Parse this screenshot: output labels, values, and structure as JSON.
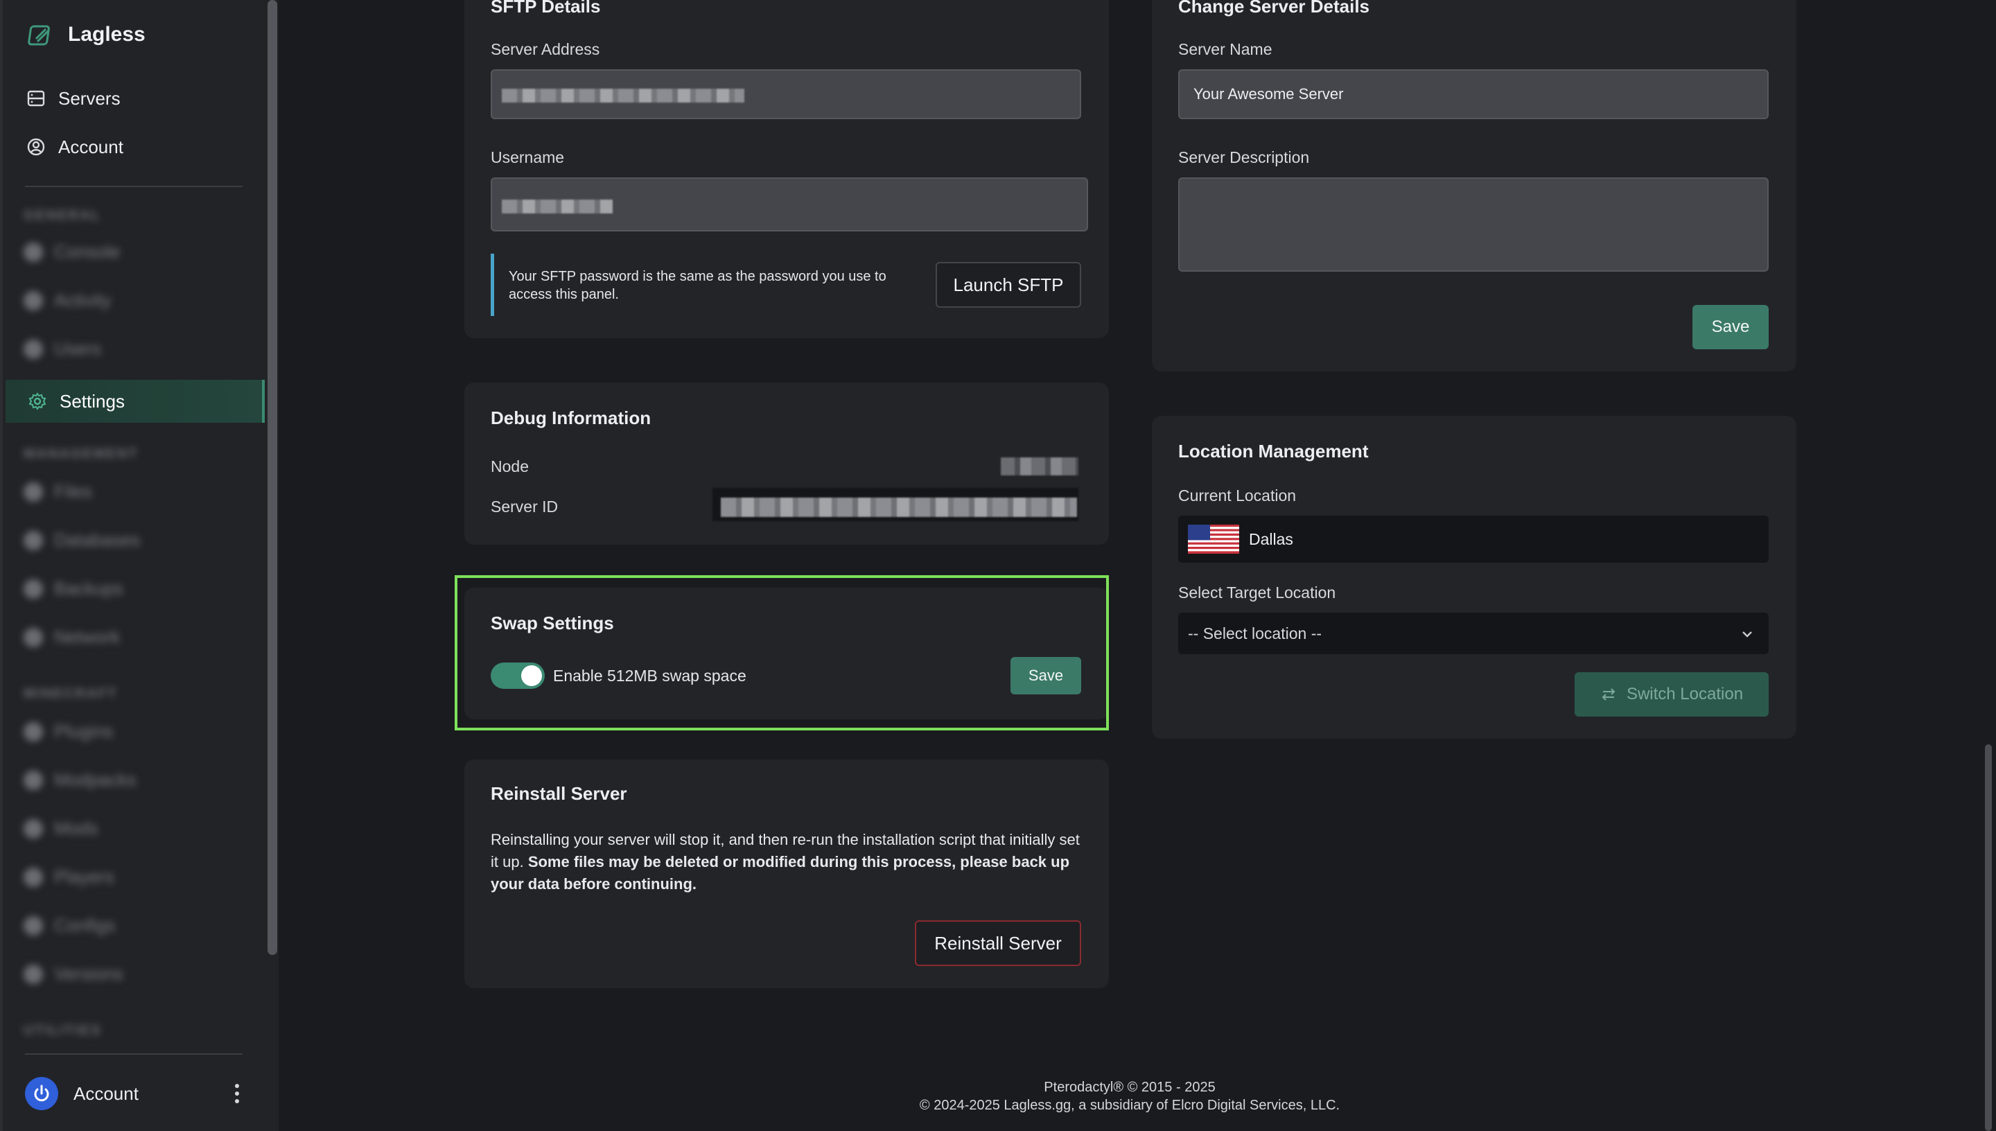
{
  "sidebar": {
    "brand": "Lagless",
    "nav": {
      "servers": "Servers",
      "account": "Account",
      "settings": "Settings"
    },
    "blurred_items": [
      "GENERAL",
      "Console",
      "Activity",
      "Users",
      "MANAGEMENT",
      "Files",
      "Databases",
      "Backups",
      "Network",
      "MINECRAFT",
      "Plugins",
      "Modpacks",
      "Mods",
      "Players",
      "Configs",
      "Versions",
      "UTILITIES"
    ],
    "footer_account": "Account"
  },
  "sftp": {
    "title": "SFTP Details",
    "server_address_label": "Server Address",
    "username_label": "Username",
    "note": "Your SFTP password is the same as the password you use to access this panel.",
    "launch_button": "Launch SFTP"
  },
  "debug": {
    "title": "Debug Information",
    "node_label": "Node",
    "server_id_label": "Server ID"
  },
  "swap": {
    "title": "Swap Settings",
    "toggle_label": "Enable 512MB swap space",
    "toggle_on": true,
    "save_button": "Save"
  },
  "reinstall": {
    "title": "Reinstall Server",
    "text_normal": "Reinstalling your server will stop it, and then re-run the installation script that initially set it up. ",
    "text_bold": "Some files may be deleted or modified during this process, please back up your data before continuing.",
    "button": "Reinstall Server"
  },
  "change_details": {
    "title": "Change Server Details",
    "name_label": "Server Name",
    "name_value": "Your Awesome Server",
    "description_label": "Server Description",
    "description_value": "",
    "save_button": "Save"
  },
  "location": {
    "title": "Location Management",
    "current_label": "Current Location",
    "current_value": "Dallas",
    "current_flag": "us-flag-icon",
    "target_label": "Select Target Location",
    "target_placeholder": "-- Select location --",
    "switch_button": "Switch Location"
  },
  "footer": {
    "line1": "Pterodactyl® © 2015 - 2025",
    "line2": "© 2024-2025 Lagless.gg, a subsidiary of Elcro Digital Services, LLC."
  },
  "colors": {
    "accent_green": "#3b7a67",
    "highlight": "#7ee05a",
    "background": "#1a1b1f",
    "card": "#232428"
  }
}
